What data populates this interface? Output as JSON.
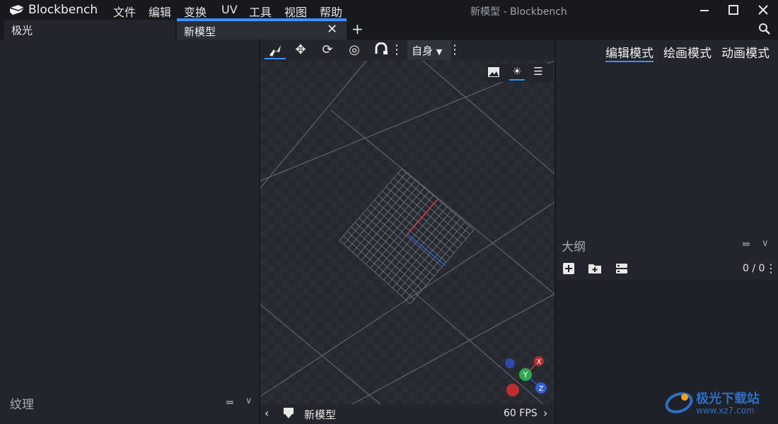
{
  "titlebar": {
    "app_name": "Blockbench",
    "window_title": "新模型 - Blockbench",
    "menu": [
      "文件",
      "编辑",
      "变换",
      "UV",
      "工具",
      "视图",
      "帮助"
    ],
    "window_buttons": [
      "minimize-icon",
      "maximize-icon",
      "close-icon"
    ]
  },
  "tabs": {
    "items": [
      {
        "label": "极光"
      },
      {
        "label": "新模型"
      }
    ]
  },
  "toolbar": {
    "tools": [
      "move-tool-icon",
      "move-arrows-icon",
      "rotate-icon",
      "pivot-icon",
      "vertex-snap-icon"
    ],
    "space": "自身"
  },
  "viewport": {
    "controls": [
      "image-icon",
      "light-icon",
      "menu-icon"
    ],
    "gizmo": {
      "x": "X",
      "y": "Y",
      "z": "Z"
    }
  },
  "statusbar": {
    "model_name": "新模型",
    "fps": "60 FPS"
  },
  "modes": {
    "edit": "编辑模式",
    "paint": "绘画模式",
    "animate": "动画模式"
  },
  "outliner": {
    "title": "大纲",
    "count": "0 / 0"
  },
  "textures": {
    "title": "纹理"
  },
  "colors": {
    "accent": "#3e90ff",
    "axis_x": "#e03a3a",
    "axis_y": "#2fa84f",
    "axis_z": "#2f5fd0"
  },
  "watermark": {
    "text": "极光下载站",
    "url": "www.xz7.com"
  }
}
